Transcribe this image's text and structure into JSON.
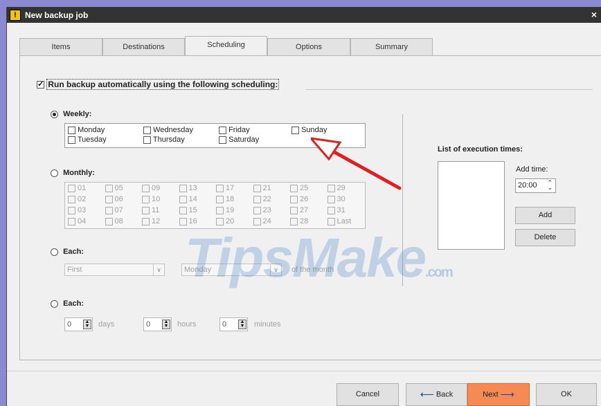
{
  "window": {
    "title": "New backup job",
    "close": "×"
  },
  "tabs": [
    "Items",
    "Destinations",
    "Scheduling",
    "Options",
    "Summary"
  ],
  "main_checkbox": {
    "label": "Run backup automatically using the following scheduling:",
    "checked": true
  },
  "weekly": {
    "label": "Weekly:",
    "days": [
      "Monday",
      "Wednesday",
      "Friday",
      "Sunday",
      "Tuesday",
      "Thursday",
      "Saturday"
    ]
  },
  "monthly": {
    "label": "Monthly:",
    "days": [
      "01",
      "05",
      "09",
      "13",
      "17",
      "21",
      "25",
      "29",
      "02",
      "06",
      "10",
      "14",
      "18",
      "22",
      "26",
      "30",
      "03",
      "07",
      "11",
      "15",
      "19",
      "23",
      "27",
      "31",
      "04",
      "08",
      "12",
      "16",
      "20",
      "24",
      "28",
      "Last"
    ]
  },
  "each1": {
    "label": "Each:",
    "first": "First",
    "weekday": "Monday",
    "suffix": "of the month"
  },
  "each2": {
    "label": "Each:",
    "days_value": "0",
    "days_label": "days",
    "hours_value": "0",
    "hours_label": "hours",
    "minutes_value": "0",
    "minutes_label": "minutes"
  },
  "exec": {
    "title": "List of execution times:",
    "add_time_label": "Add time:",
    "time_value": "20:00",
    "add": "Add",
    "delete": "Delete"
  },
  "footer": {
    "cancel": "Cancel",
    "back": "Back",
    "next": "Next",
    "ok": "OK"
  },
  "watermark": {
    "main": "TipsMake",
    "suffix": ".com"
  },
  "colors": {
    "next_button": "#f58a55",
    "arrow": "#e02020",
    "titlebar": "#333333"
  }
}
